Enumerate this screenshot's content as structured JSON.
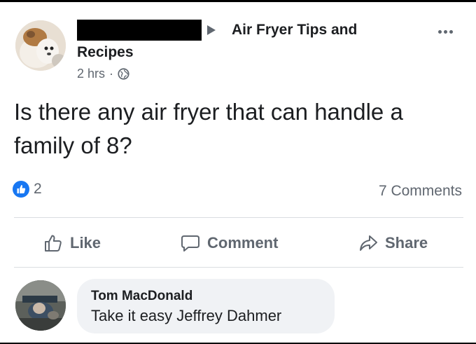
{
  "post": {
    "group_name_line1": "Air Fryer Tips and",
    "group_name_line2": "Recipes",
    "time": "2 hrs",
    "separator": "·",
    "text": "Is there any air fryer that can handle a family of 8?"
  },
  "reactions": {
    "like_count": "2",
    "comments_count": "7 Comments"
  },
  "actions": {
    "like": "Like",
    "comment": "Comment",
    "share": "Share"
  },
  "comment": {
    "author": "Tom MacDonald",
    "text": "Take it easy Jeffrey Dahmer"
  },
  "colors": {
    "text_primary": "#1c1e21",
    "text_secondary": "#606770",
    "like_blue": "#1877f2",
    "bubble_bg": "#f0f2f5",
    "divider": "#dadde1"
  },
  "icons": {
    "audience": "globe-icon",
    "reaction": "thumbs-up-icon",
    "like": "thumbs-up-outline-icon",
    "comment": "speech-bubble-icon",
    "share": "share-arrow-icon",
    "more": "more-options-icon"
  }
}
